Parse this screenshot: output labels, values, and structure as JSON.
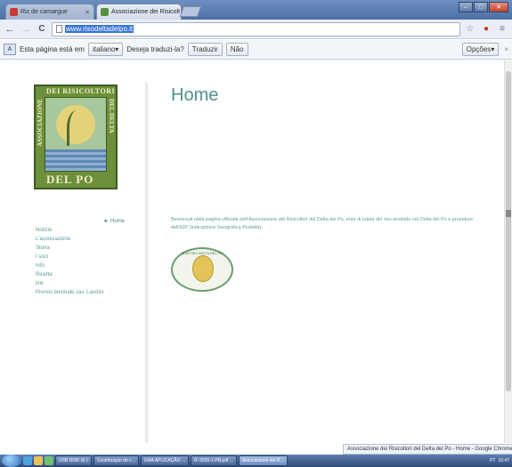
{
  "browser": {
    "tabs": [
      {
        "label": "Riz de camargue",
        "active": false,
        "favicon_color": "#c73c2f"
      },
      {
        "label": "Associazione dei Risicolt",
        "active": true,
        "favicon_color": "#5a8f3b"
      }
    ],
    "window_controls": {
      "minimize": "–",
      "maximize": "□",
      "close": "✕"
    },
    "nav": {
      "back": "←",
      "forward": "→",
      "reload": "C"
    },
    "url": "www.risodeltadelpo.it",
    "star_icon": "☆",
    "menu_icon": "≡",
    "extension_icon": "●"
  },
  "translate_bar": {
    "message": "Esta página está em",
    "language": "italiano",
    "language_arrow": "▾",
    "question": "Deseja traduzi-la?",
    "translate_button": "Traduzir",
    "no_button": "Não",
    "options_button": "Opções",
    "options_arrow": "▾",
    "close": "×"
  },
  "logo": {
    "top_text": "DEI RISICOLTORI",
    "left_text": "ASSOCIAZIONE",
    "right_text": "DEL DELTA",
    "bottom_text": "DEL PO"
  },
  "nav": {
    "current": "► Home",
    "items": [
      "Notizie",
      "L'associazione",
      "Storia",
      "I soci",
      "Info",
      "Ricette",
      "link",
      "Premio biennale cav. Landini"
    ]
  },
  "content": {
    "title": "Home",
    "intro": "Benvenuti nella pagina ufficiale dell'Associazione dei Risicoltori del Delta del Po, ente di tutela del riso prodotto nel Delta del Po e proseture dell'IGP (Indicazione Geografica Protetta).",
    "seal_text": "RISO DEL DELTA DEL PO"
  },
  "status_tooltip": "Associazione dei Risicoltori del Delta del Po - Home - Google Chrome",
  "taskbar": {
    "buttons": [
      {
        "label": "USB DISK (E:)",
        "active": false
      },
      {
        "label": "Contribuição do c...",
        "active": false
      },
      {
        "label": "UMA APLICAÇÃO ...",
        "active": false
      },
      {
        "label": "IF-3002-1-PB.pdf ...",
        "active": false
      },
      {
        "label": "Associazione dei R...",
        "active": true
      }
    ],
    "language": "PT",
    "clock": "15:47"
  }
}
